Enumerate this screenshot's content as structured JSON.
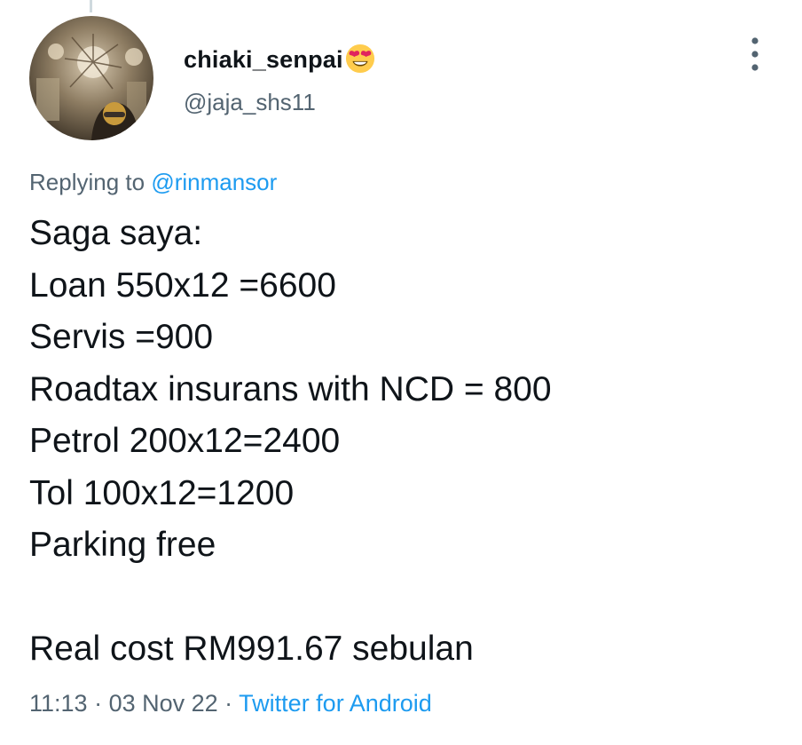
{
  "tweet": {
    "author": {
      "display_name": "chiaki_senpai",
      "emoji": "smiling-face-with-heart-eyes",
      "handle": "@jaja_shs11"
    },
    "replying_prefix": "Replying to ",
    "replying_to": "@rinmansor",
    "lines": [
      "Saga saya:",
      "Loan 550x12 =6600",
      "Servis =900",
      "Roadtax insurans with NCD = 800",
      "Petrol 200x12=2400",
      "Tol 100x12=1200",
      "Parking free",
      "",
      "Real cost RM991.67 sebulan"
    ],
    "time": "11:13",
    "separator": " · ",
    "date": "03 Nov 22",
    "source": "Twitter for Android"
  },
  "icons": {
    "more": "more-vertical-icon"
  },
  "colors": {
    "text": "#0f1419",
    "secondary": "#536471",
    "link": "#1d9bf0",
    "emoji_face": "#ffcc4d",
    "emoji_heart": "#e0245e"
  }
}
